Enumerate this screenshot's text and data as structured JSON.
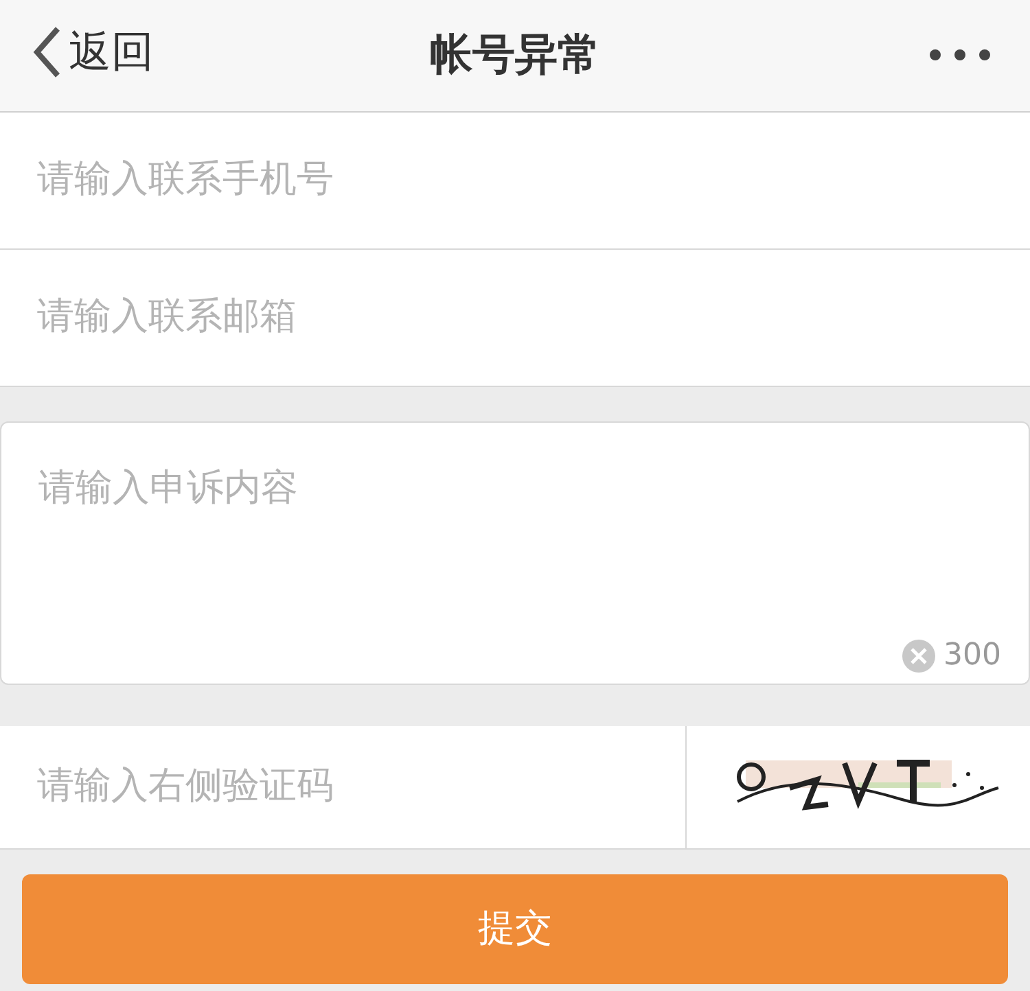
{
  "nav": {
    "back": "返回",
    "title": "帐号异常"
  },
  "fields": [
    {
      "placeholder": "请输入联系手机号"
    },
    {
      "placeholder": "请输入联系邮箱"
    }
  ],
  "complaint": {
    "placeholder": "请输入申诉内容",
    "counter": "300"
  },
  "captcha": {
    "placeholder": "请输入右侧验证码"
  },
  "submit": "提交"
}
